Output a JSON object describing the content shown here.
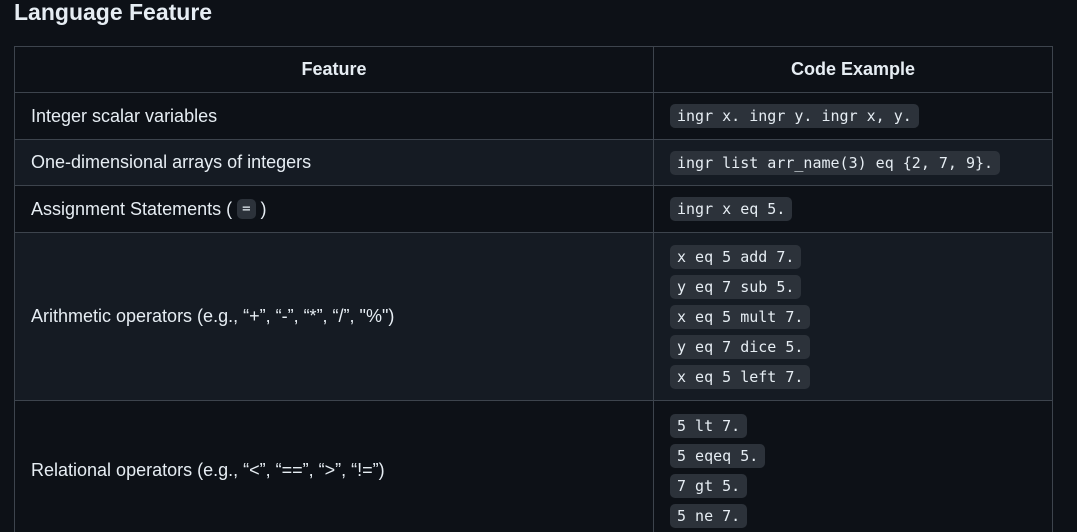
{
  "page": {
    "title": "Language Feature"
  },
  "table": {
    "headers": {
      "feature": "Feature",
      "code": "Code Example"
    },
    "rows": [
      {
        "feature": "Integer scalar variables",
        "code": [
          "ingr x. ingr y. ingr x, y."
        ]
      },
      {
        "feature": "One-dimensional arrays of integers",
        "code": [
          "ingr list arr_name(3) eq {2, 7, 9}."
        ]
      },
      {
        "feature_prefix": "Assignment Statements ( ",
        "feature_code": "=",
        "feature_suffix": " )",
        "code": [
          "ingr x eq 5."
        ]
      },
      {
        "feature": "Arithmetic operators (e.g., “+”, “-”, “*”, “/”, \"%\")",
        "code": [
          "x eq 5 add 7.",
          "y eq 7 sub 5.",
          "x eq 5 mult 7.",
          "y eq 7 dice 5.",
          "x eq 5 left 7."
        ]
      },
      {
        "feature": "Relational operators (e.g., “<”, “==”, “>”, “!=”)",
        "code": [
          "5 lt 7.",
          "5 eqeq 5.",
          "7 gt 5.",
          "5 ne 7."
        ]
      }
    ]
  },
  "colors": {
    "background": "#0d1117",
    "row_alt": "#151b23",
    "border": "#3d444d",
    "code_bg": "#2c323a",
    "text": "#e6edf3"
  }
}
